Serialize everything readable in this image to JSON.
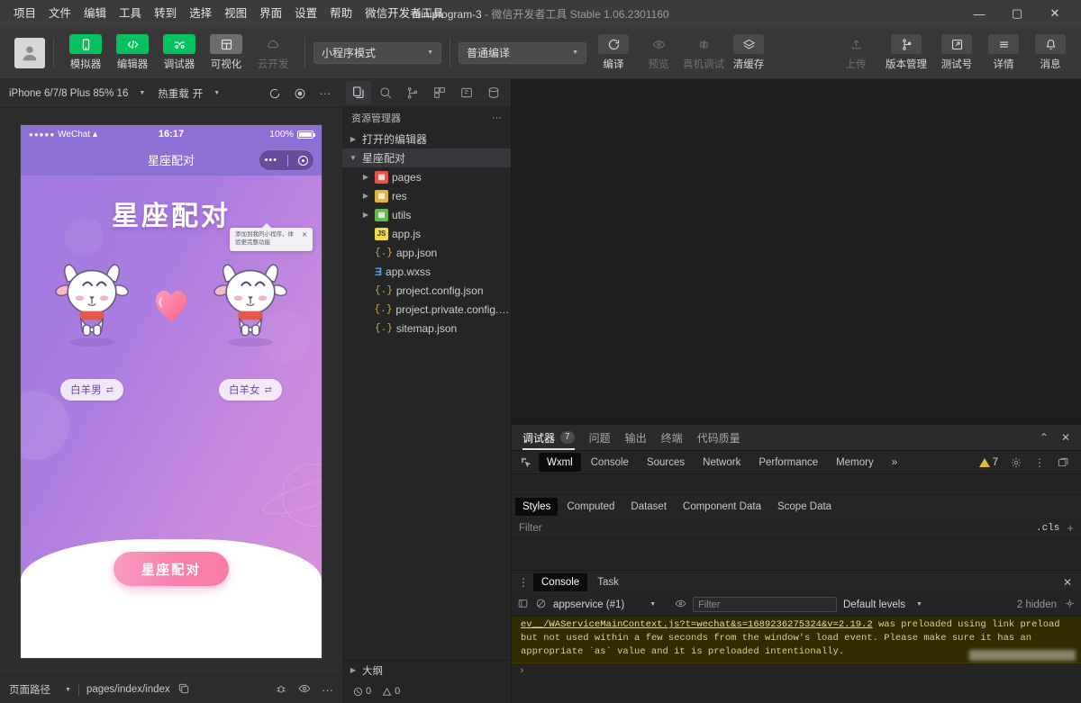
{
  "menu": {
    "items": [
      "项目",
      "文件",
      "编辑",
      "工具",
      "转到",
      "选择",
      "视图",
      "界面",
      "设置",
      "帮助",
      "微信开发者工具"
    ],
    "window_title_project": "miniprogram-3",
    "window_title_rest": " - 微信开发者工具 Stable 1.06.2301160",
    "minimize": "—",
    "maximize": "▢",
    "close": "✕"
  },
  "toolbar": {
    "buttons": [
      {
        "label": "模拟器",
        "icon": "phone-icon",
        "style": "green"
      },
      {
        "label": "编辑器",
        "icon": "code-icon",
        "style": "green"
      },
      {
        "label": "调试器",
        "icon": "debug-icon",
        "style": "green"
      },
      {
        "label": "可视化",
        "icon": "layout-icon",
        "style": "grey"
      },
      {
        "label": "云开发",
        "icon": "cloud-icon",
        "style": "off"
      }
    ],
    "mode_select": "小程序模式",
    "compile_select": "普通编译",
    "actions": [
      {
        "label": "编译",
        "icon": "refresh-icon",
        "enabled": true
      },
      {
        "label": "预览",
        "icon": "eye-icon",
        "enabled": false
      },
      {
        "label": "真机调试",
        "icon": "device-icon",
        "enabled": false
      },
      {
        "label": "清缓存",
        "icon": "layers-icon",
        "enabled": true
      }
    ],
    "right_actions": [
      {
        "label": "上传",
        "icon": "upload-icon",
        "enabled": false
      },
      {
        "label": "版本管理",
        "icon": "branch-icon",
        "enabled": true
      },
      {
        "label": "测试号",
        "icon": "external-icon",
        "enabled": true
      },
      {
        "label": "详情",
        "icon": "menu-icon",
        "enabled": true
      },
      {
        "label": "消息",
        "icon": "bell-icon",
        "enabled": true
      }
    ]
  },
  "simulator": {
    "device": "iPhone 6/7/8 Plus 85% 16",
    "hot_reload_label": "热重载",
    "hot_reload_value": "开",
    "status_path_label": "页面路径",
    "status_path_value": "pages/index/index",
    "phone": {
      "carrier": "WeChat",
      "signal_dots": "●●●●●",
      "time": "16:17",
      "battery_pct": "100%",
      "nav_title": "星座配对",
      "tip_text": "添加到我的小程序，体验更完整功能",
      "tip_close": "✕",
      "app_title": "星座配对",
      "left_pill": "白羊男",
      "right_pill": "白羊女",
      "pill_swap_icon": "⇄",
      "cta_label": "星座配对"
    }
  },
  "explorer": {
    "activity_icons": [
      "files-icon",
      "search-icon",
      "source-control-icon",
      "extensions-icon",
      "debug-panel-icon",
      "cloud-db-icon"
    ],
    "header": "资源管理器",
    "more": "···",
    "open_editors": "打开的编辑器",
    "project_root": "星座配对",
    "files": [
      {
        "name": "pages",
        "type": "folder",
        "icon": "folder-red-icon"
      },
      {
        "name": "res",
        "type": "folder",
        "icon": "folder-yellow-icon"
      },
      {
        "name": "utils",
        "type": "folder",
        "icon": "folder-green-icon"
      },
      {
        "name": "app.js",
        "type": "js",
        "icon": "js-file-icon"
      },
      {
        "name": "app.json",
        "type": "json",
        "icon": "json-file-icon"
      },
      {
        "name": "app.wxss",
        "type": "wxss",
        "icon": "wxss-file-icon"
      },
      {
        "name": "project.config.json",
        "type": "json",
        "icon": "json-file-icon"
      },
      {
        "name": "project.private.config.js...",
        "type": "json",
        "icon": "json-file-icon"
      },
      {
        "name": "sitemap.json",
        "type": "json",
        "icon": "json-file-icon"
      }
    ],
    "outline": "大纲",
    "error_count": "0",
    "warning_count": "0"
  },
  "debugger": {
    "tabs": [
      {
        "label": "调试器",
        "badge": "7",
        "active": true
      },
      {
        "label": "问题",
        "badge": "",
        "active": false
      },
      {
        "label": "输出",
        "badge": "",
        "active": false
      },
      {
        "label": "终端",
        "badge": "",
        "active": false
      },
      {
        "label": "代码质量",
        "badge": "",
        "active": false
      }
    ],
    "collapse_icon": "⌃",
    "close_icon": "✕",
    "devtools_tabs": [
      "Wxml",
      "Console",
      "Sources",
      "Network",
      "Performance",
      "Memory"
    ],
    "devtools_active": "Wxml",
    "more_tabs": "»",
    "warning_count": "7",
    "styles_tabs": [
      "Styles",
      "Computed",
      "Dataset",
      "Component Data",
      "Scope Data"
    ],
    "styles_active": "Styles",
    "filter_placeholder": "Filter",
    "cls_label": ".cls",
    "add_rule": "+"
  },
  "console": {
    "tabs": [
      "Console",
      "Task"
    ],
    "active_tab": "Console",
    "close_icon": "✕",
    "context": "appservice (#1)",
    "filter_placeholder": "Filter",
    "levels": "Default levels",
    "hidden_count": "2 hidden",
    "messages": [
      {
        "type": "warning",
        "link": "ev__/WAServiceMainContext.js?t=wechat&s=1689236275324&v=2.19.2",
        "text": " was preloaded using link preload but not used within a few seconds from the window's load event. Please make sure it has an appropriate `as` value and it is preloaded intentionally."
      }
    ],
    "prompt": "›"
  }
}
